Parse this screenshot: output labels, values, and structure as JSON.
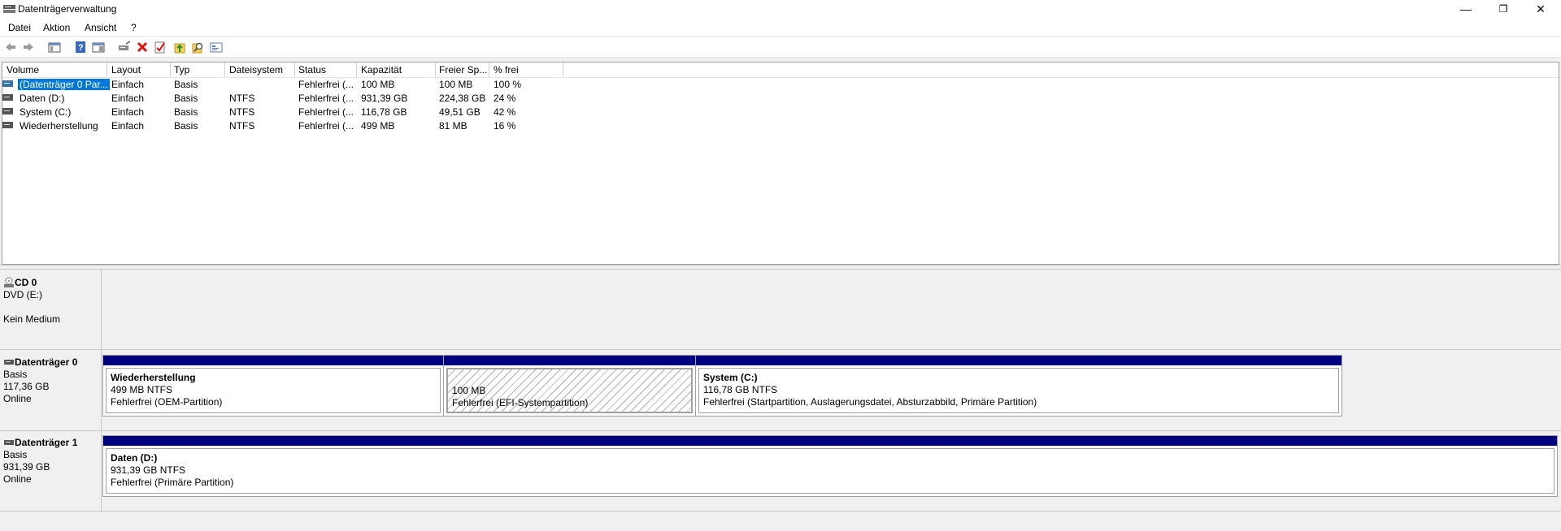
{
  "window": {
    "title": "Datenträgerverwaltung",
    "minimize": "—",
    "restore": "❐",
    "close": "✕"
  },
  "menu": [
    "Datei",
    "Aktion",
    "Ansicht",
    "?"
  ],
  "toolbar": [
    "back-icon",
    "forward-icon",
    "console-tree-icon",
    "help-icon",
    "properties-icon",
    "rescan-icon",
    "delete-icon",
    "check-icon",
    "format-icon",
    "search-icon",
    "settings-icon"
  ],
  "columns": [
    "Volume",
    "Layout",
    "Typ",
    "Dateisystem",
    "Status",
    "Kapazität",
    "Freier Sp...",
    "% frei"
  ],
  "volumes": [
    {
      "volume": "(Datenträger 0 Par...",
      "layout": "Einfach",
      "typ": "Basis",
      "fs": "",
      "status": "Fehlerfrei (...",
      "cap": "100 MB",
      "free": "100 MB",
      "pct": "100 %"
    },
    {
      "volume": "Daten (D:)",
      "layout": "Einfach",
      "typ": "Basis",
      "fs": "NTFS",
      "status": "Fehlerfrei (...",
      "cap": "931,39 GB",
      "free": "224,38 GB",
      "pct": "24 %"
    },
    {
      "volume": "System (C:)",
      "layout": "Einfach",
      "typ": "Basis",
      "fs": "NTFS",
      "status": "Fehlerfrei (...",
      "cap": "116,78 GB",
      "free": "49,51 GB",
      "pct": "42 %"
    },
    {
      "volume": "Wiederherstellung",
      "layout": "Einfach",
      "typ": "Basis",
      "fs": "NTFS",
      "status": "Fehlerfrei (...",
      "cap": "499 MB",
      "free": "81 MB",
      "pct": "16 %"
    }
  ],
  "disks": {
    "cd0": {
      "name": "CD 0",
      "l1": "DVD (E:)",
      "l2": "Kein Medium"
    },
    "d0": {
      "name": "Datenträger 0",
      "l1": "Basis",
      "l2": "117,36 GB",
      "l3": "Online",
      "parts": [
        {
          "title": "Wiederherstellung",
          "size": "499 MB NTFS",
          "status": "Fehlerfrei (OEM-Partition)"
        },
        {
          "title": "",
          "size": "100 MB",
          "status": "Fehlerfrei (EFI-Systempartition)"
        },
        {
          "title": "System  (C:)",
          "size": "116,78 GB NTFS",
          "status": "Fehlerfrei (Startpartition, Auslagerungsdatei, Absturzabbild, Primäre Partition)"
        }
      ]
    },
    "d1": {
      "name": "Datenträger 1",
      "l1": "Basis",
      "l2": "931,39 GB",
      "l3": "Online",
      "parts": [
        {
          "title": "Daten  (D:)",
          "size": "931,39 GB NTFS",
          "status": "Fehlerfrei (Primäre Partition)"
        }
      ]
    }
  },
  "colors": {
    "partition_bar": "#00007f"
  }
}
